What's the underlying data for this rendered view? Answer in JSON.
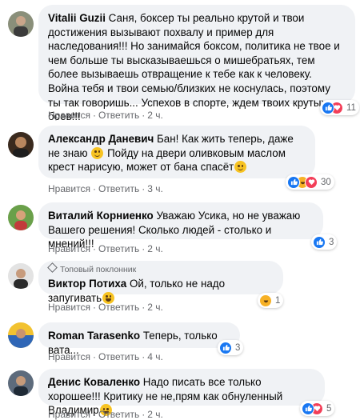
{
  "colors": {
    "bubble_bg": "#f0f2f5",
    "meta_text": "#65676b",
    "like": "#1877f2",
    "love": "#f33e58",
    "haha": "#f7b125"
  },
  "comments": [
    {
      "author": "Vitalii Guzii",
      "text": "Саня, боксер ты реально крутой и твои достижения вызывают похвалу и пример для наследования!!! Но занимайся боксом, политика не твое и чем больше ты высказываешься о мишебратьях, тем более вызываешь отвращение к тебе как к человеку. Война тебя и твои семью/близких не коснулась, поэтому ты так говоришь... Успехов в спорте, ждем твоих крутых боев!!!",
      "like": "Нравится",
      "reply": "Ответить",
      "time": "2 ч.",
      "reactions": [
        "like-icon",
        "love-icon"
      ],
      "reaction_count": "11"
    },
    {
      "author": "Александр Даневич",
      "text_before": "Бан! Как жить теперь, даже не знаю",
      "emoji1": "thinking-emoji",
      "text_middle": "Пойду на двери оливковым маслом крест нарисую, может от бана спасёт",
      "emoji2": "smirk-emoji",
      "like": "Нравится",
      "reply": "Ответить",
      "time": "3 ч.",
      "reactions": [
        "like-icon",
        "haha-icon",
        "love-icon"
      ],
      "reaction_count": "30"
    },
    {
      "author": "Виталий Корниенко",
      "text": "Уважаю Усика, но не уважаю Вашего решения! Сколько людей - столько и мнений!!!",
      "like": "Нравится",
      "reply": "Ответить",
      "time": "2 ч.",
      "reactions": [
        "like-icon"
      ],
      "reaction_count": "3"
    },
    {
      "badge": "Топовый поклонник",
      "author": "Виктор Потиха",
      "text": "Ой, только не надо запугивать",
      "emoji": "laughing-emoji",
      "like": "Нравится",
      "reply": "Ответить",
      "time": "2 ч.",
      "reactions": [
        "haha-icon"
      ],
      "reaction_count": "1"
    },
    {
      "author": "Roman Tarasenko",
      "text": "Теперь, только вата...",
      "like": "Нравится",
      "reply": "Ответить",
      "time": "4 ч.",
      "reactions": [
        "like-icon"
      ],
      "reaction_count": "3"
    },
    {
      "author": "Денис Коваленко",
      "text": "Надо писать все только хорошее!!! Критику не не,прям как обнуленный Владимир",
      "emoji": "laughing-emoji",
      "like": "Нравится",
      "reply": "Ответить",
      "time": "2 ч.",
      "reactions": [
        "like-icon",
        "love-icon"
      ],
      "reaction_count": "5"
    }
  ]
}
